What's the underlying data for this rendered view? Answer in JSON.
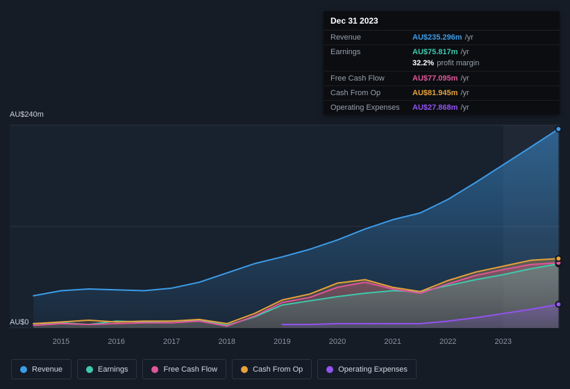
{
  "tooltip": {
    "date": "Dec 31 2023",
    "rows": [
      {
        "label": "Revenue",
        "value": "AU$235.296m",
        "unit": "/yr",
        "color": "#3d9ce8"
      },
      {
        "label": "Earnings",
        "value": "AU$75.817m",
        "unit": "/yr",
        "color": "#3fc8ad"
      },
      {
        "label": "",
        "value": "32.2%",
        "unit": "profit margin",
        "color": "#ffffff"
      },
      {
        "label": "Free Cash Flow",
        "value": "AU$77.095m",
        "unit": "/yr",
        "color": "#e0569a"
      },
      {
        "label": "Cash From Op",
        "value": "AU$81.945m",
        "unit": "/yr",
        "color": "#e6a23c"
      },
      {
        "label": "Operating Expenses",
        "value": "AU$27.868m",
        "unit": "/yr",
        "color": "#9353f0"
      }
    ]
  },
  "axis": {
    "y_top_label": "AU$240m",
    "y_bottom_label": "AU$0"
  },
  "chart_data": {
    "type": "area",
    "title": "",
    "unit": "AU$m",
    "ylim": [
      0,
      240
    ],
    "legend_position": "bottom",
    "grid": true,
    "x": [
      2014.5,
      2015,
      2015.5,
      2016,
      2016.5,
      2017,
      2017.5,
      2018,
      2018.5,
      2019,
      2019.5,
      2020,
      2020.5,
      2021,
      2021.5,
      2022,
      2022.5,
      2023,
      2023.5,
      2024
    ],
    "x_ticks": [
      "2015",
      "2016",
      "2017",
      "2018",
      "2019",
      "2020",
      "2021",
      "2022",
      "2023"
    ],
    "y_axis_labels": [
      "AU$0",
      "AU$240m"
    ],
    "series": [
      {
        "name": "Revenue",
        "color": "#3d9ce8",
        "values": [
          38,
          44,
          46,
          45,
          44,
          47,
          54,
          65,
          76,
          84,
          93,
          104,
          117,
          128,
          136,
          152,
          172,
          193,
          214,
          235.296
        ]
      },
      {
        "name": "Earnings",
        "color": "#3fc8ad",
        "values": [
          5,
          6,
          4,
          8,
          7,
          8,
          9,
          3,
          13,
          27,
          32,
          37,
          41,
          44,
          43,
          50,
          57,
          63,
          70,
          75.817
        ]
      },
      {
        "name": "Free Cash Flow",
        "color": "#e0569a",
        "values": [
          3,
          5,
          4,
          5,
          6,
          6,
          8,
          2,
          14,
          30,
          36,
          48,
          54,
          46,
          41,
          52,
          62,
          69,
          75,
          77.095
        ]
      },
      {
        "name": "Cash From Op",
        "color": "#e6a23c",
        "values": [
          5,
          7,
          9,
          7,
          8,
          8,
          10,
          5,
          17,
          33,
          40,
          53,
          57,
          48,
          43,
          56,
          66,
          73,
          80,
          81.945
        ]
      },
      {
        "name": "Operating Expenses",
        "color": "#9353f0",
        "values": [
          null,
          null,
          null,
          null,
          null,
          null,
          null,
          null,
          null,
          4,
          4,
          5,
          5,
          5,
          5,
          8,
          12,
          17,
          22,
          27.868
        ]
      }
    ]
  },
  "legend": {
    "items": [
      {
        "label": "Revenue",
        "color": "#3d9ce8"
      },
      {
        "label": "Earnings",
        "color": "#3fc8ad"
      },
      {
        "label": "Free Cash Flow",
        "color": "#e0569a"
      },
      {
        "label": "Cash From Op",
        "color": "#e6a23c"
      },
      {
        "label": "Operating Expenses",
        "color": "#9353f0"
      }
    ]
  }
}
